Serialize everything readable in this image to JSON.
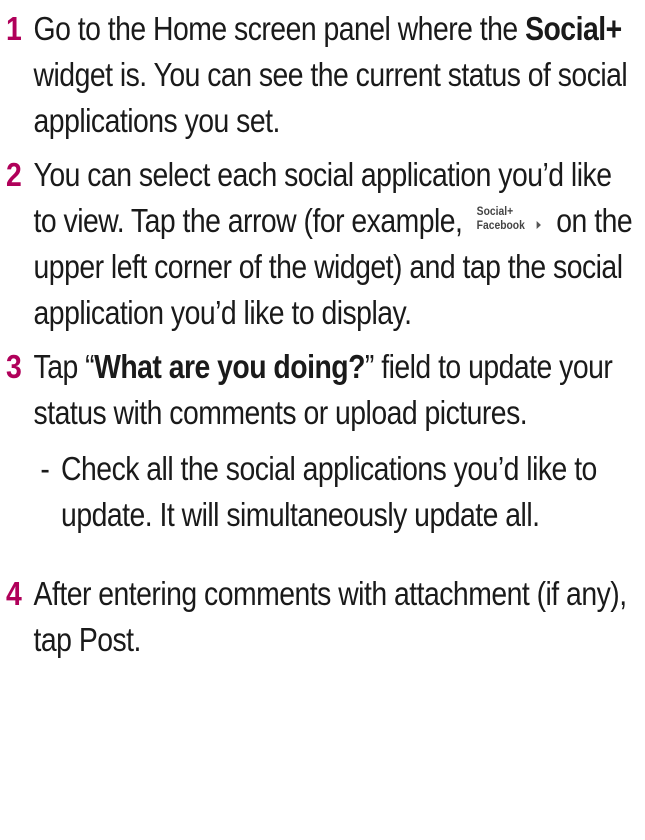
{
  "steps": [
    {
      "number": "1",
      "parts": {
        "a": "Go to the Home screen panel where the ",
        "b_bold": "Social+",
        "c": " widget is. You can see the current status of social applications you set."
      }
    },
    {
      "number": "2",
      "parts": {
        "a": "You can select each social application you’d like to view. Tap the arrow (for example, ",
        "c": " on the upper left corner of the widget) and tap the social application you’d like to display."
      },
      "widget": {
        "line1": "Social+",
        "line2": "Facebook",
        "arrow_icon": "right-arrow-icon"
      }
    },
    {
      "number": "3",
      "parts": {
        "a": "Tap “",
        "b_bold": "What are you doing?",
        "c": "” field to update your status with comments or upload pictures."
      },
      "sub": {
        "dash": "-",
        "text": "Check all the social applications you’d like to update. It will simultaneously update all."
      }
    },
    {
      "number": "4",
      "parts": {
        "a": "After entering comments with attachment (if any), tap Post."
      }
    }
  ],
  "colors": {
    "step_number": "#b0005a",
    "text": "#1a1a1a"
  }
}
